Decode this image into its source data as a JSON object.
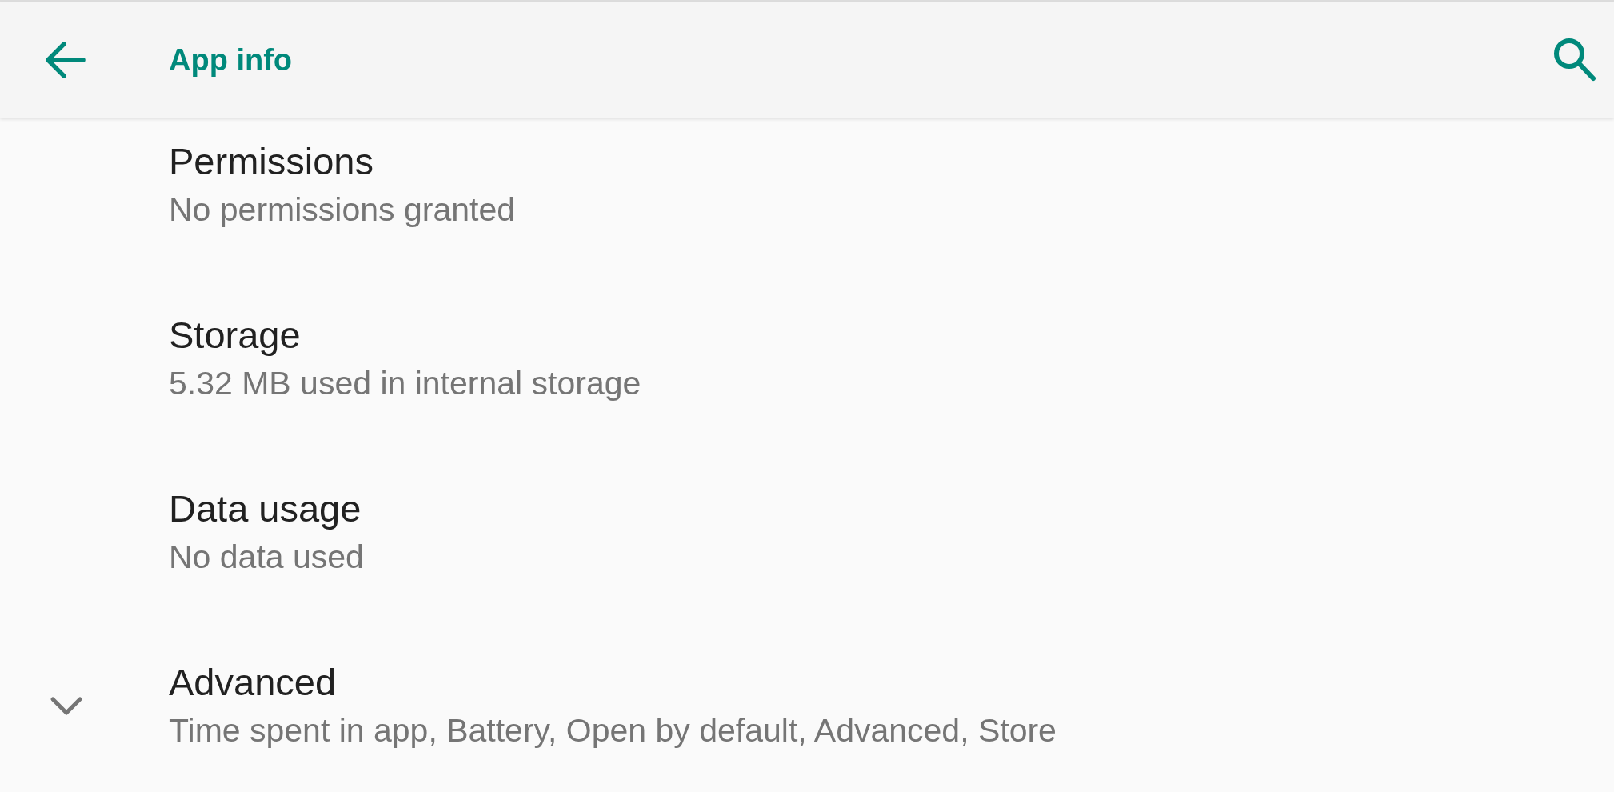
{
  "toolbar": {
    "title": "App info"
  },
  "items": [
    {
      "title": "Permissions",
      "summary": "No permissions granted"
    },
    {
      "title": "Storage",
      "summary": "5.32 MB used in internal storage"
    },
    {
      "title": "Data usage",
      "summary": "No data used"
    }
  ],
  "advanced": {
    "title": "Advanced",
    "summary": "Time spent in app, Battery, Open by default, Advanced, Store",
    "expanded": false
  }
}
